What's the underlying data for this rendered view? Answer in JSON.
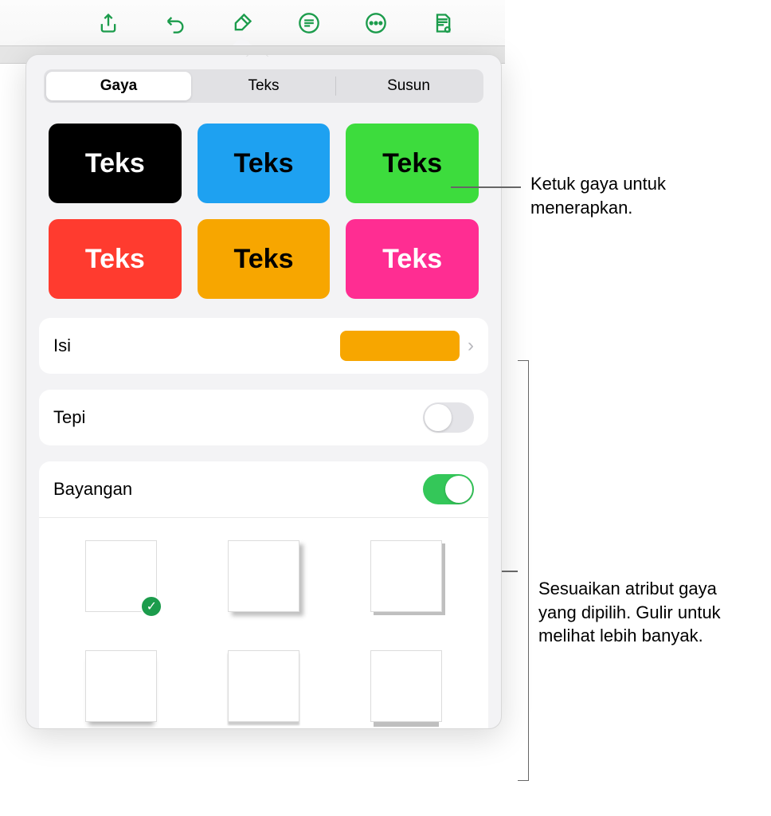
{
  "toolbar": {
    "icons": [
      "share-icon",
      "undo-icon",
      "format-brush-icon",
      "list-icon",
      "more-icon",
      "document-view-icon"
    ],
    "active_index": 2
  },
  "tabs": {
    "items": [
      {
        "label": "Gaya",
        "active": true
      },
      {
        "label": "Teks",
        "active": false
      },
      {
        "label": "Susun",
        "active": false
      }
    ]
  },
  "styles": [
    {
      "label": "Teks",
      "bg": "#000000",
      "fg": "#ffffff"
    },
    {
      "label": "Teks",
      "bg": "#1ea1f1",
      "fg": "#000000"
    },
    {
      "label": "Teks",
      "bg": "#3ddc3d",
      "fg": "#000000"
    },
    {
      "label": "Teks",
      "bg": "#ff3b2f",
      "fg": "#ffffff"
    },
    {
      "label": "Teks",
      "bg": "#f7a600",
      "fg": "#000000"
    },
    {
      "label": "Teks",
      "bg": "#ff2d92",
      "fg": "#ffffff"
    }
  ],
  "fill": {
    "label": "Isi",
    "color": "#f7a600"
  },
  "border": {
    "label": "Tepi",
    "enabled": false
  },
  "shadow": {
    "label": "Bayangan",
    "enabled": true,
    "selected_index": 0
  },
  "callouts": {
    "apply_style": "Ketuk gaya untuk menerapkan.",
    "customize": "Sesuaikan atribut gaya yang dipilih. Gulir untuk melihat lebih banyak."
  }
}
